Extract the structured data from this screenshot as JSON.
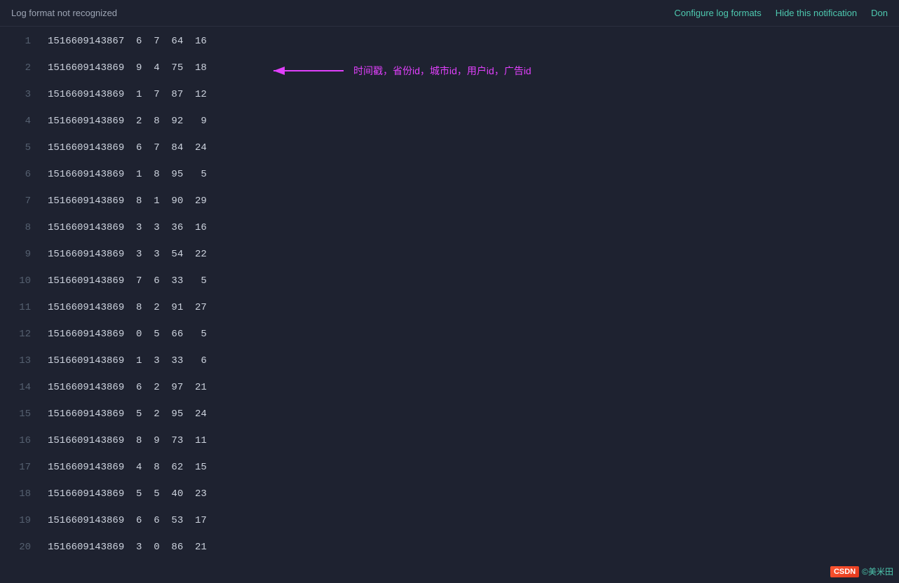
{
  "notification": {
    "message": "Log format not recognized",
    "configure_label": "Configure log formats",
    "hide_label": "Hide this notification",
    "dismiss_label": "Don"
  },
  "annotation": {
    "text": "时间戳，省份id，城市id，用户id，广告id"
  },
  "lines": [
    {
      "num": 1,
      "content": "1516609143867  6  7  64  16"
    },
    {
      "num": 2,
      "content": "1516609143869  9  4  75  18"
    },
    {
      "num": 3,
      "content": "1516609143869  1  7  87  12"
    },
    {
      "num": 4,
      "content": "1516609143869  2  8  92   9"
    },
    {
      "num": 5,
      "content": "1516609143869  6  7  84  24"
    },
    {
      "num": 6,
      "content": "1516609143869  1  8  95   5"
    },
    {
      "num": 7,
      "content": "1516609143869  8  1  90  29"
    },
    {
      "num": 8,
      "content": "1516609143869  3  3  36  16"
    },
    {
      "num": 9,
      "content": "1516609143869  3  3  54  22"
    },
    {
      "num": 10,
      "content": "1516609143869  7  6  33   5"
    },
    {
      "num": 11,
      "content": "1516609143869  8  2  91  27"
    },
    {
      "num": 12,
      "content": "1516609143869  0  5  66   5"
    },
    {
      "num": 13,
      "content": "1516609143869  1  3  33   6"
    },
    {
      "num": 14,
      "content": "1516609143869  6  2  97  21"
    },
    {
      "num": 15,
      "content": "1516609143869  5  2  95  24"
    },
    {
      "num": 16,
      "content": "1516609143869  8  9  73  11"
    },
    {
      "num": 17,
      "content": "1516609143869  4  8  62  15"
    },
    {
      "num": 18,
      "content": "1516609143869  5  5  40  23"
    },
    {
      "num": 19,
      "content": "1516609143869  6  6  53  17"
    },
    {
      "num": 20,
      "content": "1516609143869  3  0  86  21"
    }
  ],
  "watermark": {
    "brand": "CSDN",
    "username": "©美米田"
  }
}
